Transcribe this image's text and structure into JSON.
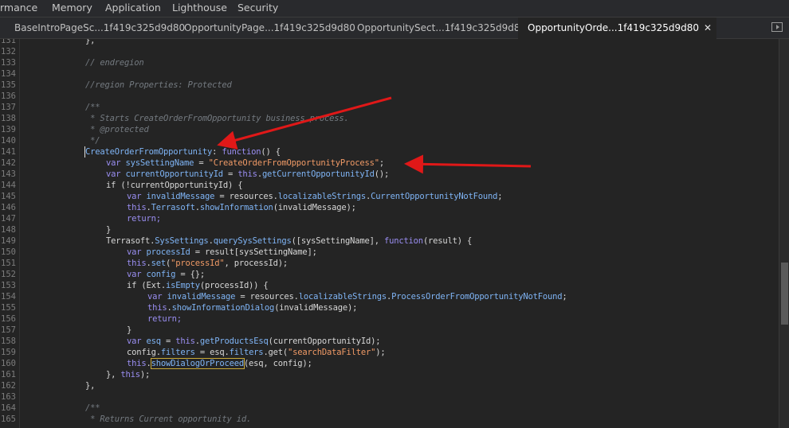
{
  "devtools_tabs": [
    "rmance",
    "Memory",
    "Application",
    "Lighthouse",
    "Security"
  ],
  "file_tabs": [
    {
      "label": "BaseIntroPageSc...1f419c325d9d80",
      "active": false
    },
    {
      "label": "OpportunityPage...1f419c325d9d80",
      "active": false
    },
    {
      "label": "OpportunitySect...1f419c325d9d80",
      "active": false
    },
    {
      "label": "OpportunityOrde...1f419c325d9d80",
      "active": true
    }
  ],
  "close_glyph": "✕",
  "line_numbers": [
    "131",
    "132",
    "133",
    "134",
    "135",
    "136",
    "137",
    "138",
    "139",
    "140",
    "141",
    "142",
    "143",
    "144",
    "145",
    "146",
    "147",
    "148",
    "149",
    "150",
    "151",
    "152",
    "153",
    "154",
    "155",
    "156",
    "157",
    "158",
    "159",
    "160",
    "161",
    "162",
    "163",
    "164",
    "165"
  ],
  "code": {
    "l131": "},",
    "l133": "// endregion",
    "l135": "//region Properties: Protected",
    "l137": "/**",
    "l138": " * Starts CreateOrderFromOpportunity business process.",
    "l139": " * @protected",
    "l140": " */",
    "l141_name": "CreateOrderFromOpportunity",
    "l141_colon": ": ",
    "l141_fn": "function",
    "l141_rest": "() {",
    "l142_var": "var ",
    "l142_name": "sysSettingName",
    "l142_eq": " = ",
    "l142_str": "\"CreateOrderFromOpportunityProcess\"",
    "l142_end": ";",
    "l143_var": "var ",
    "l143_name": "currentOpportunityId",
    "l143_eq": " = ",
    "l143_this": "this",
    "l143_dot": ".",
    "l143_call": "getCurrentOpportunityId",
    "l143_end": "();",
    "l144": "if (!currentOpportunityId) {",
    "l145_var": "var ",
    "l145_name": "invalidMessage",
    "l145_eq": " = resources.",
    "l145_prop": "localizableStrings",
    "l145_dot": ".",
    "l145_prop2": "CurrentOpportunityNotFound",
    "l145_end": ";",
    "l146_this": "this",
    "l146_dot": ".",
    "l146_ns": "Terrasoft",
    "l146_dot2": ".",
    "l146_call": "showInformation",
    "l146_end": "(invalidMessage);",
    "l147": "return;",
    "l148": "}",
    "l149_a": "Terrasoft.",
    "l149_ns": "SysSettings",
    "l149_dot": ".",
    "l149_call": "querySysSettings",
    "l149_mid": "([sysSettingName], ",
    "l149_fn": "function",
    "l149_end": "(result) {",
    "l150_var": "var ",
    "l150_name": "processId",
    "l150_rest": " = result[sysSettingName];",
    "l151_this": "this",
    "l151_dot": ".",
    "l151_call": "set",
    "l151_open": "(",
    "l151_str": "\"processId\"",
    "l151_end": ", processId);",
    "l152_var": "var ",
    "l152_name": "config",
    "l152_rest": " = {};",
    "l153_a": "if (Ext.",
    "l153_call": "isEmpty",
    "l153_end": "(processId)) {",
    "l154_var": "var ",
    "l154_name": "invalidMessage",
    "l154_eq": " = resources.",
    "l154_prop": "localizableStrings",
    "l154_dot": ".",
    "l154_prop2": "ProcessOrderFromOpportunityNotFound",
    "l154_end": ";",
    "l155_this": "this",
    "l155_dot": ".",
    "l155_call": "showInformationDialog",
    "l155_end": "(invalidMessage);",
    "l156": "return;",
    "l157": "}",
    "l158_var": "var ",
    "l158_name": "esq",
    "l158_eq": " = ",
    "l158_this": "this",
    "l158_dot": ".",
    "l158_call": "getProductsEsq",
    "l158_end": "(currentOpportunityId);",
    "l159_a": "config.",
    "l159_prop": "filters",
    "l159_b": " = esq.",
    "l159_prop2": "filters",
    "l159_c": ".get(",
    "l159_str": "\"searchDataFilter\"",
    "l159_end": ");",
    "l160_this": "this",
    "l160_dot": ".",
    "l160_call": "showDialogOrProceed",
    "l160_end": "(esq, config);",
    "l161_a": "}, ",
    "l161_this": "this",
    "l161_end": ");",
    "l162": "},",
    "l164": "/**",
    "l165": " * Returns Current opportunity id."
  }
}
